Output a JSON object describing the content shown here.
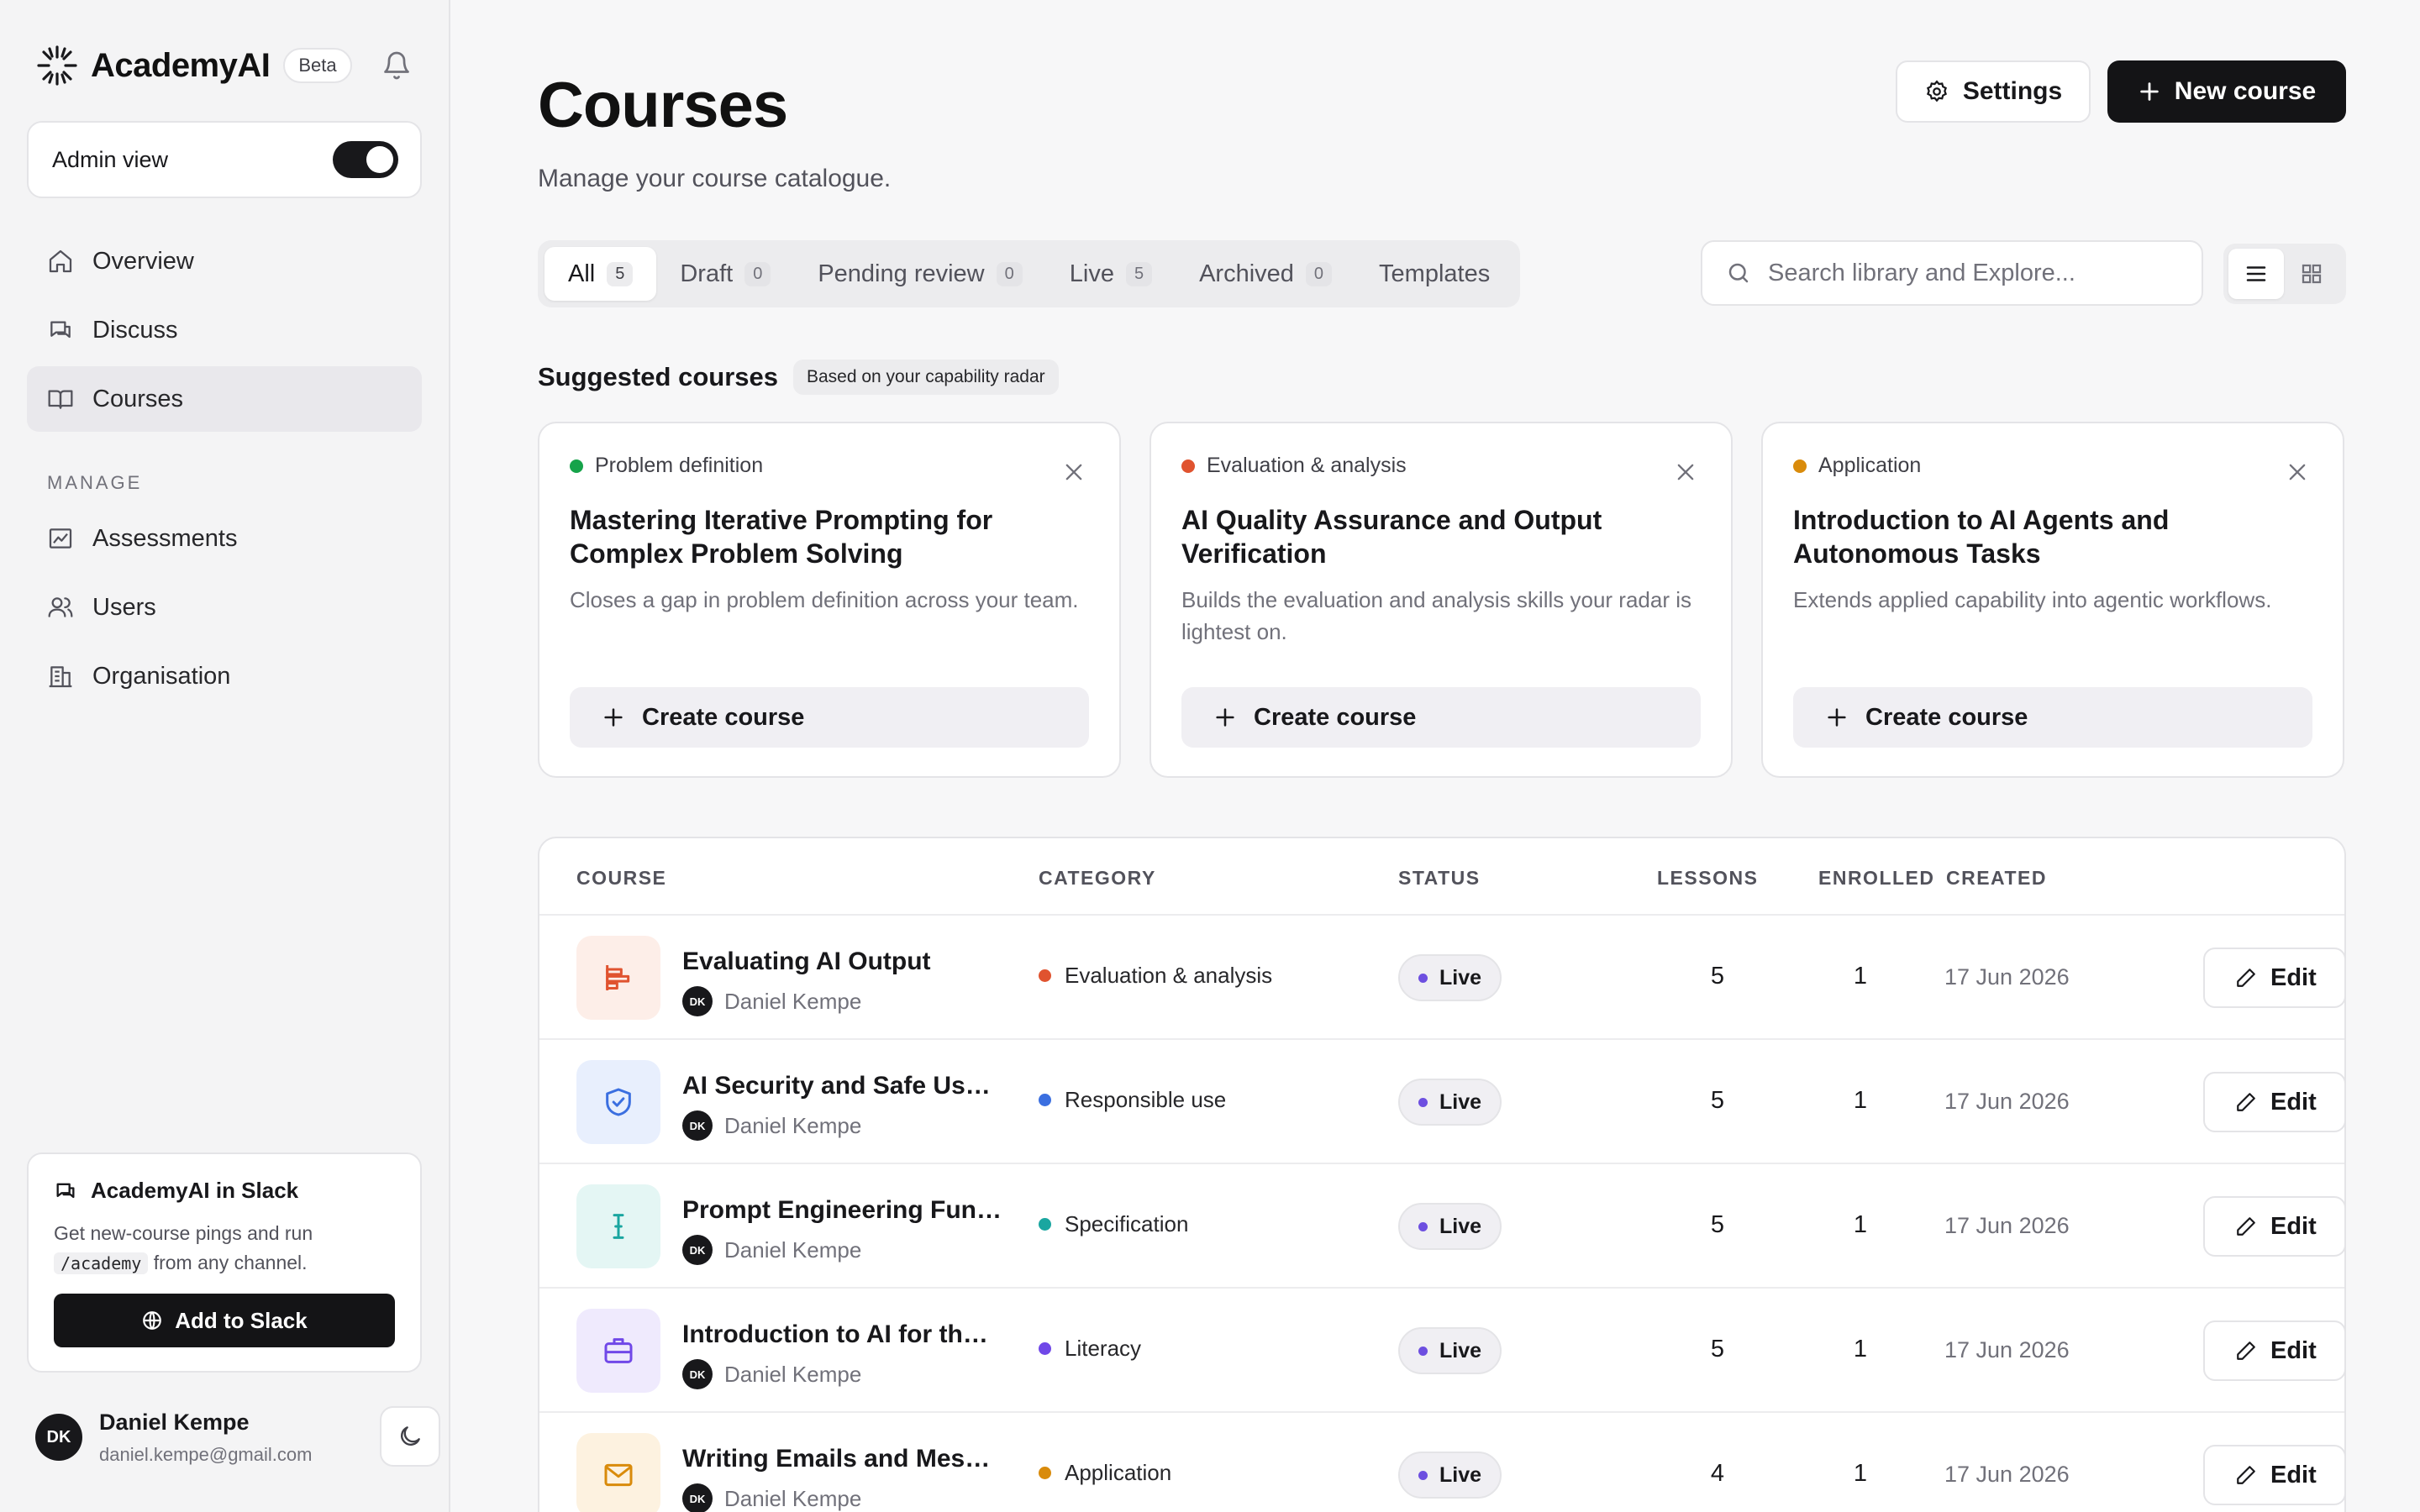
{
  "brand": {
    "name": "AcademyAI",
    "badge": "Beta"
  },
  "admin": {
    "label": "Admin view",
    "enabled": true
  },
  "nav": [
    {
      "label": "Overview",
      "icon": "home-icon"
    },
    {
      "label": "Discuss",
      "icon": "chat-icon"
    },
    {
      "label": "Courses",
      "icon": "book-icon",
      "active": true
    }
  ],
  "manage": {
    "heading": "MANAGE",
    "items": [
      {
        "label": "Assessments",
        "icon": "chart-icon"
      },
      {
        "label": "Users",
        "icon": "users-icon"
      },
      {
        "label": "Organisation",
        "icon": "building-icon"
      }
    ]
  },
  "slack": {
    "title": "AcademyAI in Slack",
    "desc_before": "Get new-course pings and run",
    "code": "/academy",
    "desc_after": "from any channel.",
    "button": "Add to Slack"
  },
  "user": {
    "initials": "DK",
    "name": "Daniel Kempe",
    "email": "daniel.kempe@gmail.com"
  },
  "page": {
    "title": "Courses",
    "subtitle": "Manage your course catalogue."
  },
  "actions": {
    "settings": "Settings",
    "new_course": "New course"
  },
  "tabs": [
    {
      "label": "All",
      "count": "5",
      "active": true
    },
    {
      "label": "Draft",
      "count": "0"
    },
    {
      "label": "Pending review",
      "count": "0"
    },
    {
      "label": "Live",
      "count": "5"
    },
    {
      "label": "Archived",
      "count": "0"
    },
    {
      "label": "Templates"
    }
  ],
  "search": {
    "placeholder": "Search library and Explore..."
  },
  "suggested": {
    "title": "Suggested courses",
    "badge": "Based on your capability radar",
    "button": "Create course",
    "cards": [
      {
        "category": "Problem definition",
        "color": "#16a34a",
        "title": "Mastering Iterative Prompting for Complex Problem Solving",
        "desc": "Closes a gap in problem definition across your team."
      },
      {
        "category": "Evaluation & analysis",
        "color": "#e0532f",
        "title": "AI Quality Assurance and Output Verification",
        "desc": "Builds the evaluation and analysis skills your radar is lightest on."
      },
      {
        "category": "Application",
        "color": "#d98b0b",
        "title": "Introduction to AI Agents and Autonomous Tasks",
        "desc": "Extends applied capability into agentic workflows."
      }
    ]
  },
  "table": {
    "headers": {
      "course": "COURSE",
      "category": "CATEGORY",
      "status": "STATUS",
      "lessons": "LESSONS",
      "enrolled": "ENROLLED",
      "created": "CREATED"
    },
    "edit_label": "Edit",
    "rows": [
      {
        "name": "Evaluating AI Output",
        "author": "Daniel Kempe",
        "initials": "DK",
        "category": "Evaluation & analysis",
        "cat_color": "#e0532f",
        "status": "Live",
        "lessons": "5",
        "enrolled": "1",
        "created": "17 Jun 2026",
        "icon": "chart-bars-icon",
        "icon_bg": "#fdeee8",
        "icon_color": "#e0532f"
      },
      {
        "name": "AI Security and Safe Use at Work",
        "author": "Daniel Kempe",
        "initials": "DK",
        "category": "Responsible use",
        "cat_color": "#3b6fe0",
        "status": "Live",
        "lessons": "5",
        "enrolled": "1",
        "created": "17 Jun 2026",
        "icon": "shield-check-icon",
        "icon_bg": "#e8effd",
        "icon_color": "#3b6fe0"
      },
      {
        "name": "Prompt Engineering Fundamentals",
        "author": "Daniel Kempe",
        "initials": "DK",
        "category": "Specification",
        "cat_color": "#1aa6a0",
        "status": "Live",
        "lessons": "5",
        "enrolled": "1",
        "created": "17 Jun 2026",
        "icon": "text-cursor-icon",
        "icon_bg": "#e4f6f4",
        "icon_color": "#1aa6a0"
      },
      {
        "name": "Introduction to AI for the Workplace",
        "author": "Daniel Kempe",
        "initials": "DK",
        "category": "Literacy",
        "cat_color": "#7048e8",
        "status": "Live",
        "lessons": "5",
        "enrolled": "1",
        "created": "17 Jun 2026",
        "icon": "briefcase-icon",
        "icon_bg": "#efeafd",
        "icon_color": "#7048e8"
      },
      {
        "name": "Writing Emails and Messages with AI",
        "author": "Daniel Kempe",
        "initials": "DK",
        "category": "Application",
        "cat_color": "#d98b0b",
        "status": "Live",
        "lessons": "4",
        "enrolled": "1",
        "created": "17 Jun 2026",
        "icon": "mail-icon",
        "icon_bg": "#fdf2e0",
        "icon_color": "#d98b0b"
      }
    ]
  }
}
